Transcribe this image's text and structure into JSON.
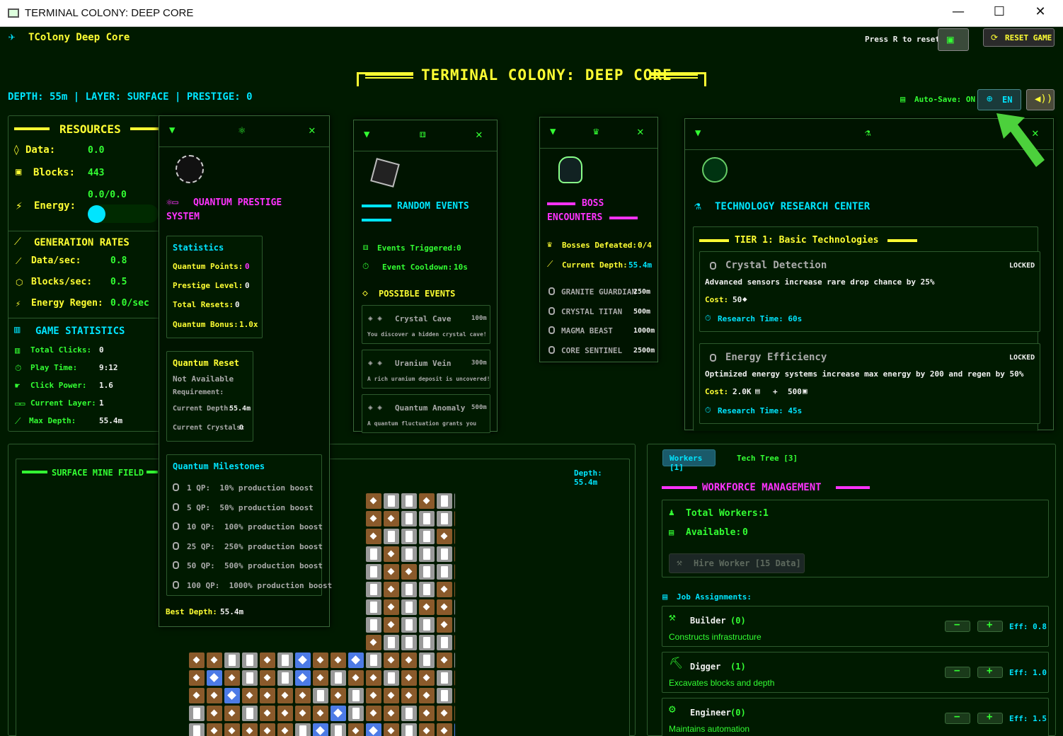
{
  "window": {
    "title": "TERMINAL COLONY: DEEP CORE"
  },
  "header": {
    "app_name": "TColony Deep Core",
    "reset_hint": "Press R to reset",
    "reset_button": "RESET GAME",
    "main_title": "TERMINAL COLONY: DEEP CORE",
    "status_line": "DEPTH: 55m | LAYER: SURFACE | PRESTIGE: 0",
    "autosave": "Auto-Save: ON",
    "language": "EN"
  },
  "resources": {
    "title": "RESOURCES",
    "data_label": "Data:",
    "data_value": "0.0",
    "blocks_label": "Blocks:",
    "blocks_value": "443",
    "energy_label": "Energy:",
    "energy_value": "0.0/0.0",
    "energy_fill": 0
  },
  "rates": {
    "title": "GENERATION RATES",
    "data_label": "Data/sec:",
    "data_value": "0.8",
    "blocks_label": "Blocks/sec:",
    "blocks_value": "0.5",
    "energy_label": "Energy Regen:",
    "energy_value": "0.0/sec"
  },
  "stats": {
    "title": "GAME STATISTICS",
    "clicks_label": "Total Clicks:",
    "clicks_value": "0",
    "play_label": "Play Time:",
    "play_value": "9:12",
    "power_label": "Click Power:",
    "power_value": "1.6",
    "layer_label": "Current Layer:",
    "layer_value": "1",
    "depth_label": "Max Depth:",
    "depth_value": "55.4m"
  },
  "prestige": {
    "title": "QUANTUM PRESTIGE SYSTEM",
    "stats_title": "Statistics",
    "qp_label": "Quantum Points:",
    "qp_value": "0",
    "level_label": "Prestige Level:",
    "level_value": "0",
    "resets_label": "Total Resets:",
    "resets_value": "0",
    "bonus_label": "Quantum Bonus:",
    "bonus_value": "1.0x",
    "reset_title": "Quantum Reset",
    "reset_status": "Not Available",
    "requirement": "Requirement:",
    "cur_depth_label": "Current Depth:",
    "cur_depth_value": "55.4m",
    "cur_crystals_label": "Current Crystals:",
    "cur_crystals_value": "0",
    "milestones_title": "Quantum Milestones",
    "milestones": [
      "1 QP:  10% production boost",
      "5 QP:  50% production boost",
      "10 QP:  100% production boost",
      "25 QP:  250% production boost",
      "50 QP:  500% production boost",
      "100 QP:  1000% production boost"
    ],
    "best_depth_label": "Best Depth:",
    "best_depth_value": "55.4m"
  },
  "events": {
    "title": "RANDOM EVENTS",
    "triggered_label": "Events Triggered:",
    "triggered_value": "0",
    "cooldown_label": "Event Cooldown:",
    "cooldown_value": "10s",
    "possible_title": "POSSIBLE EVENTS",
    "items": [
      {
        "name": "Crystal Cave",
        "depth": "100m",
        "desc": "You discover a hidden crystal cave!"
      },
      {
        "name": "Uranium Vein",
        "depth": "300m",
        "desc": "A rich uranium deposit is uncovered!"
      },
      {
        "name": "Quantum Anomaly",
        "depth": "500m",
        "desc": "A quantum fluctuation grants you"
      }
    ]
  },
  "bosses": {
    "title_1": "BOSS",
    "title_2": "ENCOUNTERS",
    "defeated_label": "Bosses Defeated:",
    "defeated_value": "0/4",
    "depth_label": "Current Depth:",
    "depth_value": "55.4m",
    "list": [
      {
        "name": "GRANITE GUARDIAN",
        "depth": "250m"
      },
      {
        "name": "CRYSTAL TITAN",
        "depth": "500m"
      },
      {
        "name": "MAGMA BEAST",
        "depth": "1000m"
      },
      {
        "name": "CORE SENTINEL",
        "depth": "2500m"
      }
    ]
  },
  "tech": {
    "title": "TECHNOLOGY RESEARCH CENTER",
    "tier": "TIER 1: Basic Technologies",
    "items": [
      {
        "name": "Crystal Detection",
        "status": "LOCKED",
        "desc": "Advanced sensors increase rare drop chance by 25%",
        "cost_label": "Cost:",
        "cost": "50",
        "time": "Research Time: 60s"
      },
      {
        "name": "Energy Efficiency",
        "status": "LOCKED",
        "desc": "Optimized energy systems increase max energy by 200 and regen by 50%",
        "cost_label": "Cost:",
        "cost": "2.0K",
        "cost_plus": "+",
        "cost2": "500",
        "time": "Research Time: 45s"
      }
    ]
  },
  "minefield": {
    "title": "SURFACE MINE FIELD",
    "depth": "Depth: 55.4m"
  },
  "workforce": {
    "tab_workers": "Workers [1]",
    "tab_tech": "Tech Tree [3]",
    "title": "WORKFORCE MANAGEMENT",
    "total_label": "Total Workers:",
    "total_value": "1",
    "avail_label": "Available:",
    "avail_value": "0",
    "hire": "Hire Worker [15 Data]",
    "jobs_title": "Job Assignments:",
    "jobs": [
      {
        "name": "Builder",
        "count": "(0)",
        "desc": "Constructs infrastructure",
        "eff": "Eff: 0.8"
      },
      {
        "name": "Digger",
        "count": "(1)",
        "desc": "Excavates blocks and depth",
        "eff": "Eff: 1.0"
      },
      {
        "name": "Engineer",
        "count": "(0)",
        "desc": "Maintains automation",
        "eff": "Eff: 1.5"
      }
    ]
  },
  "colors": {
    "accent_yellow": "#ffff33",
    "accent_green": "#33ff33",
    "accent_cyan": "#00e5ff",
    "accent_magenta": "#ff33ff",
    "background": "#001a00"
  },
  "minegrid": {
    "rows": [
      "..........bssbssssb",
      "..........bbsssbssb",
      "..........bsssbbssb",
      "..........sbsssbsss",
      "..........sbbssbssb",
      "..........sbssbbsss",
      "..........sbsbbssbs",
      "..........sbssbssbs",
      "..........bssssbssb",
      "bbssbscbbcsbbsbsbcb",
      "bcbsbscbsbbsbbsbbsc",
      "bbcbbbbsbsbbbbsbbbs",
      "sbbsbbbbcsbbsbbbbbs",
      "sbbbbbscsbcbsbbcsbs",
      "sbcbbsbcsbsbbbcbssb"
    ]
  }
}
